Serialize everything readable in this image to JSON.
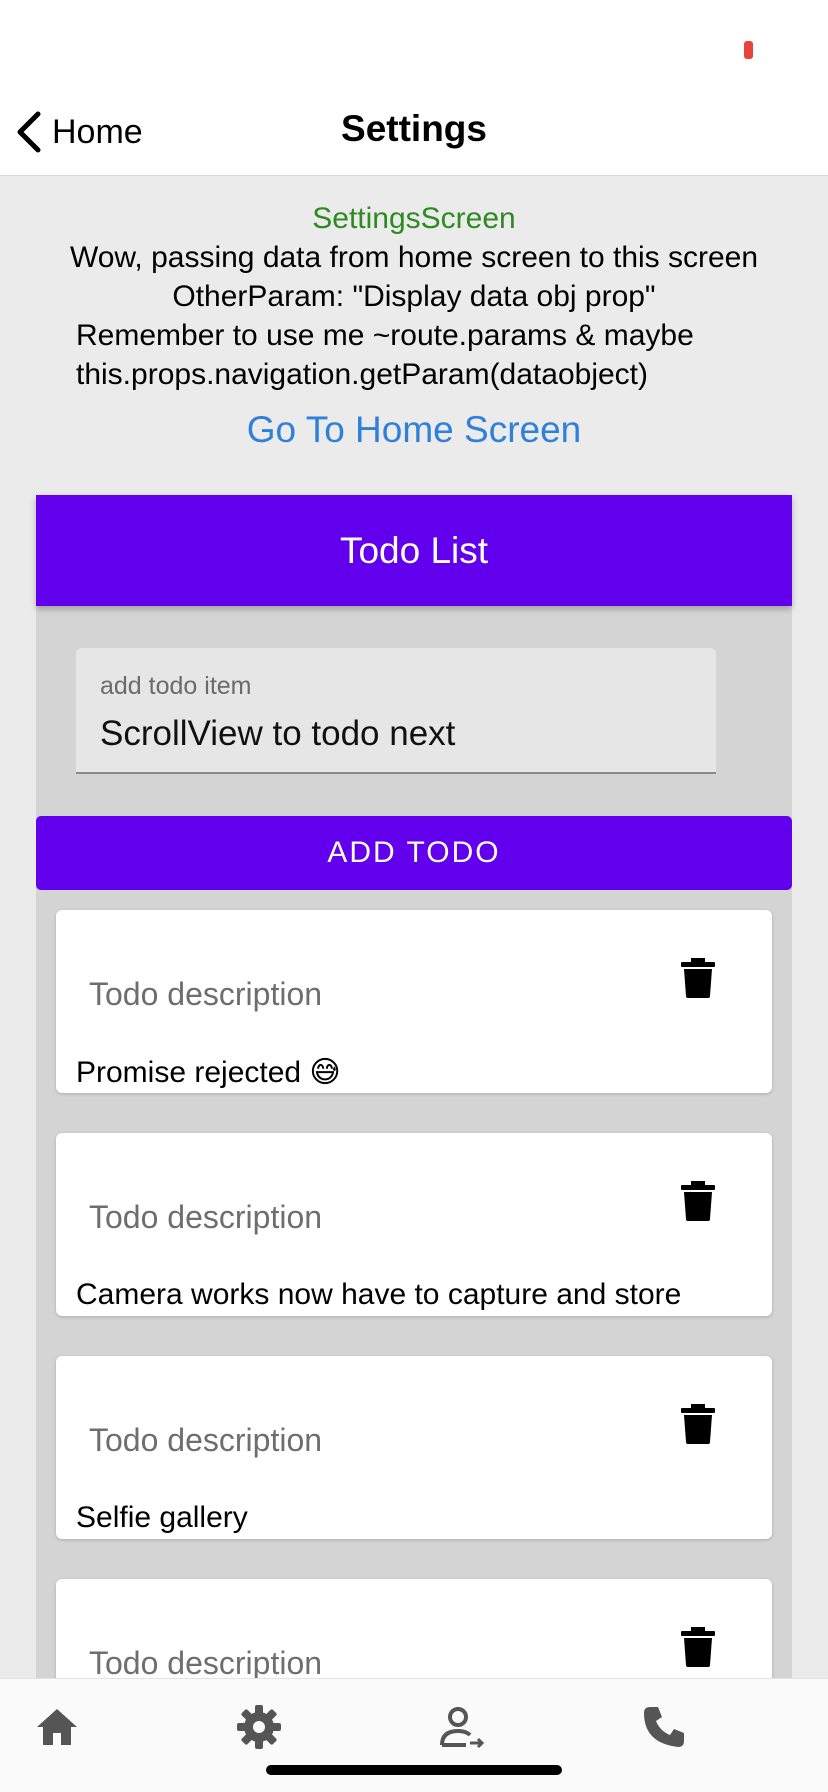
{
  "colors": {
    "accent": "#6200ee",
    "link": "#2f80d8",
    "screen_name": "#2e8b22",
    "status_indicator": "#e8433b"
  },
  "nav": {
    "back_label": "Home",
    "title": "Settings"
  },
  "info": {
    "screen_name": "SettingsScreen",
    "line1": "Wow, passing data from home screen to this screen",
    "line2": "OtherParam: \"Display data obj prop\"",
    "line3": "Remember to use me ~route.params & maybe",
    "line4": "this.props.navigation.getParam(dataobject)",
    "go_home_label": "Go To Home Screen"
  },
  "todo": {
    "header": "Todo List",
    "input": {
      "label": "add todo item",
      "value": "ScrollView to todo next"
    },
    "add_button": "ADD TODO",
    "items": [
      {
        "description_label": "Todo description",
        "text": "Promise rejected 😅",
        "icon": "trash-icon"
      },
      {
        "description_label": "Todo description",
        "text": "Camera works now have to capture and store",
        "icon": "trash-icon"
      },
      {
        "description_label": "Todo description",
        "text": "Selfie gallery",
        "icon": "trash-icon"
      },
      {
        "description_label": "Todo description",
        "text": "",
        "icon": "trash-icon"
      }
    ]
  },
  "tabbar": {
    "tabs": [
      {
        "icon": "home-icon"
      },
      {
        "icon": "gear-icon"
      },
      {
        "icon": "user-transfer-icon"
      },
      {
        "icon": "phone-icon"
      }
    ]
  }
}
